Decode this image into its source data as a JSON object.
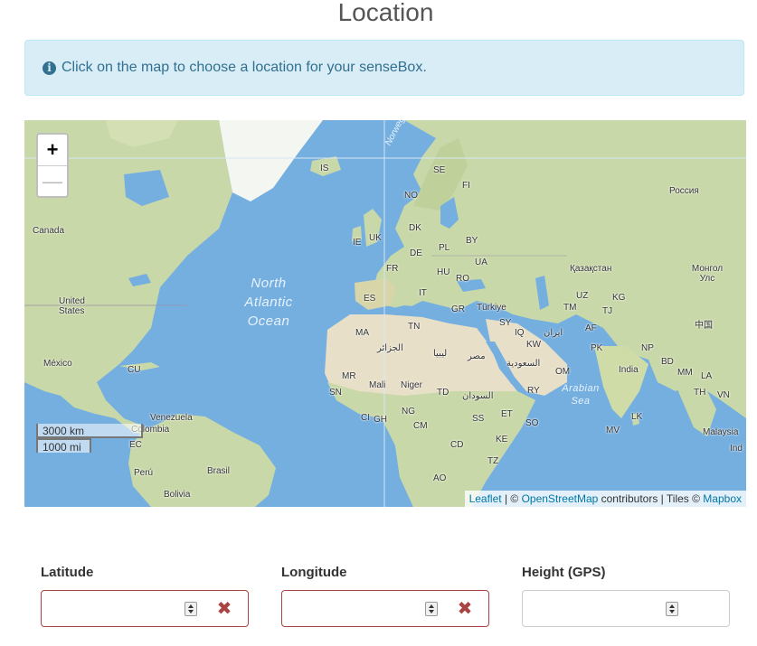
{
  "page": {
    "title": "Location"
  },
  "alert": {
    "icon": "info-circle-icon",
    "text": "Click on the map to choose a location for your senseBox."
  },
  "map": {
    "zoom_in": "+",
    "zoom_out": "—",
    "scale_km": "3000 km",
    "scale_mi": "1000 mi",
    "ocean_label": "North Atlantic Ocean",
    "ocean_label_lines": [
      "North",
      "Atlantic",
      "Ocean"
    ],
    "arabian_sea": "Arabian Sea",
    "arabian_sea_lines": [
      "Arabian",
      "Sea"
    ],
    "norwegian_sea": "Norwegian Sea",
    "country_labels": {
      "is": "IS",
      "se": "SE",
      "fi": "FI",
      "no": "NO",
      "russia": "Россия",
      "canada": "Canada",
      "dk": "DK",
      "ie": "IE",
      "uk": "UK",
      "pl": "PL",
      "by": "BY",
      "de": "DE",
      "ua": "UA",
      "fr": "FR",
      "hu": "HU",
      "ro": "RO",
      "kazakhstan": "Қазақстан",
      "mongolia": "Монгол Улс",
      "us": "United States",
      "it": "IT",
      "es": "ES",
      "gr": "GR",
      "turkiye": "Türkiye",
      "uz": "UZ",
      "kg": "KG",
      "tm": "TM",
      "tj": "TJ",
      "china": "中国",
      "tn": "TN",
      "sy": "SY",
      "iq": "IQ",
      "iran": "ایران",
      "af": "AF",
      "ma": "MA",
      "algeria": "الجزائر",
      "libya": "ليبيا",
      "egypt": "مصر",
      "kw": "KW",
      "pk": "PK",
      "np": "NP",
      "mexico": "México",
      "cu": "CU",
      "saudi": "السعودية",
      "om": "OM",
      "india": "India",
      "bd": "BD",
      "mm": "MM",
      "la": "LA",
      "mr": "MR",
      "mali": "Mali",
      "niger": "Niger",
      "td": "TD",
      "sudan": "السودان",
      "ry": "RY",
      "sn": "SN",
      "th": "TH",
      "vn": "VN",
      "venezuela": "Venezuela",
      "ci": "CI",
      "gh": "GH",
      "ng": "NG",
      "et": "ET",
      "colombia": "Colombia",
      "ec": "EC",
      "cm": "CM",
      "ss": "SS",
      "so": "SO",
      "lk": "LK",
      "malaysia": "Malaysia",
      "ke": "KE",
      "mv": "MV",
      "ind": "Ind",
      "cd": "CD",
      "peru": "Perú",
      "brasil": "Brasil",
      "tz": "TZ",
      "ao": "AO",
      "bolivia": "Bolivia"
    },
    "attribution": {
      "leaflet": "Leaflet",
      "sep1": " | © ",
      "osm": "OpenStreetMap",
      "contributors": " contributors | Tiles © ",
      "mapbox": "Mapbox"
    }
  },
  "fields": {
    "latitude": {
      "label": "Latitude",
      "value": "",
      "clear_icon": "close-x-icon"
    },
    "longitude": {
      "label": "Longitude",
      "value": "",
      "clear_icon": "close-x-icon"
    },
    "height": {
      "label": "Height (GPS)",
      "value": ""
    }
  },
  "colors": {
    "alert_bg": "#d9edf7",
    "alert_text": "#31708f",
    "ocean": "#74afe0",
    "land": "#c9d8a8",
    "desert": "#e8dfc8",
    "error": "#a94442",
    "link": "#0078a8"
  }
}
